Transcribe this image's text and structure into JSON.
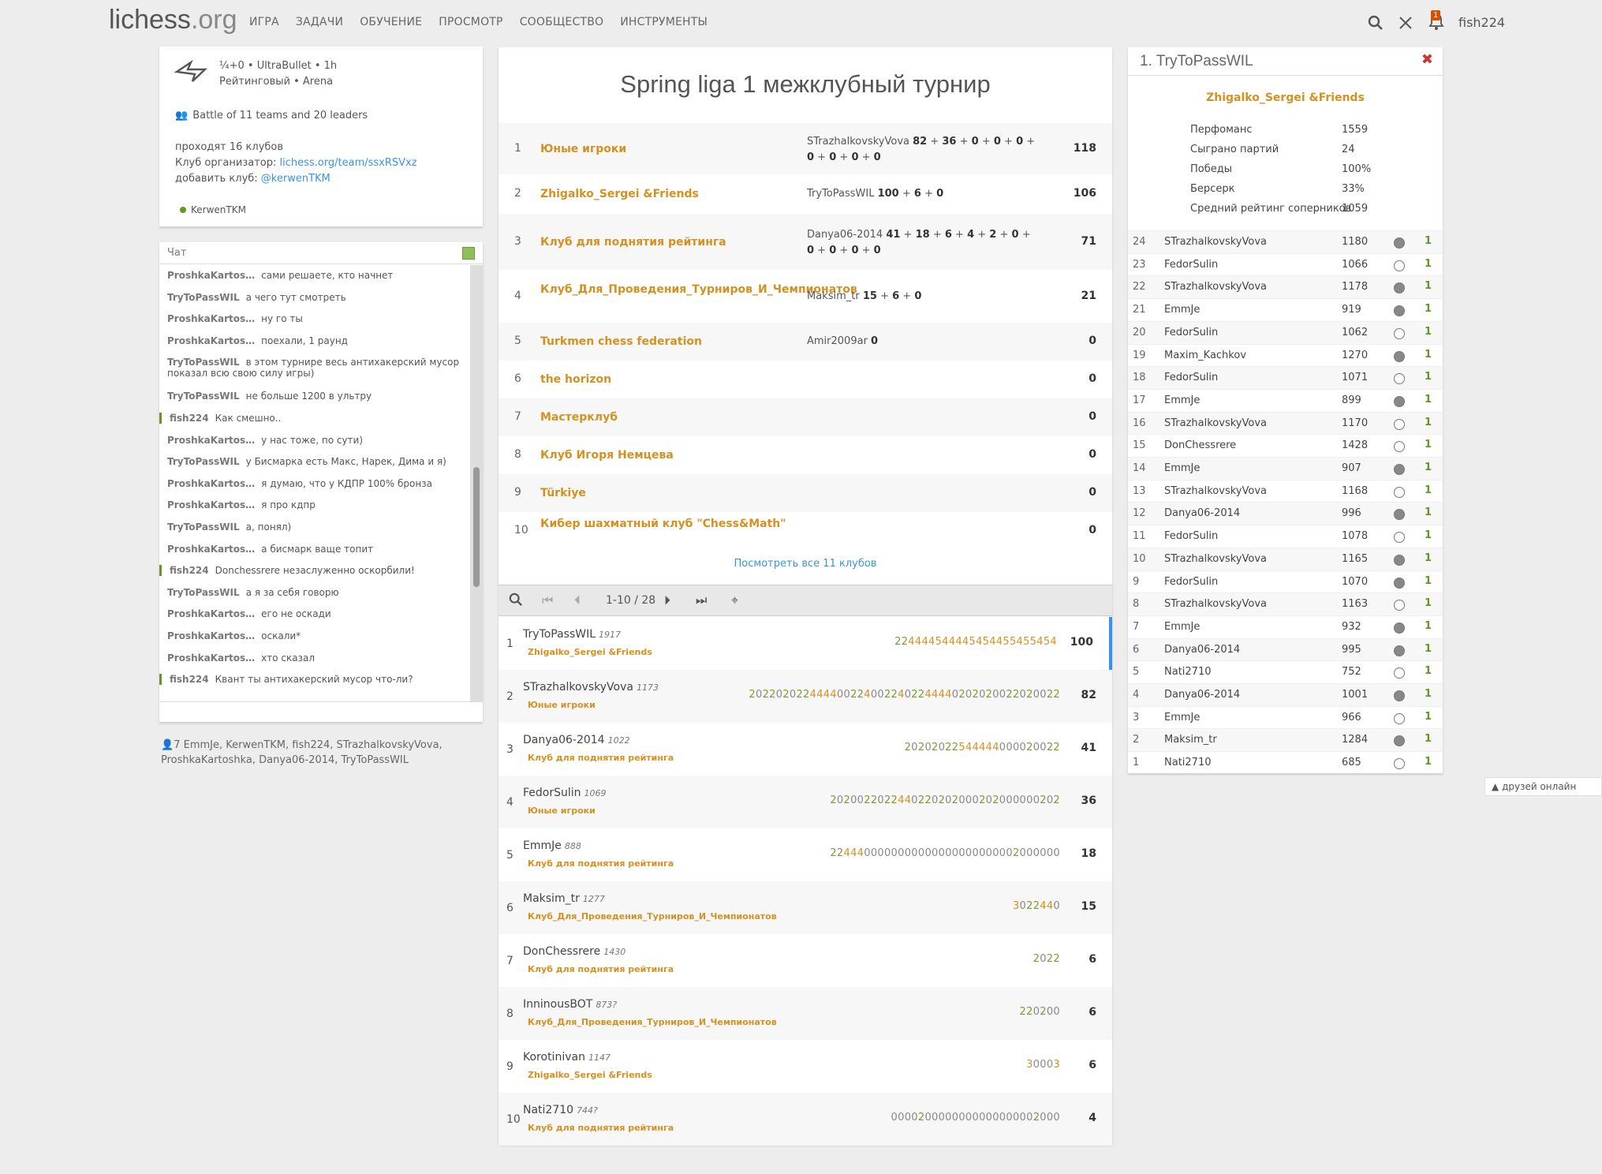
{
  "header": {
    "logo_main": "lichess",
    "logo_ext": ".org",
    "nav": [
      "ИГРА",
      "ЗАДАЧИ",
      "ОБУЧЕНИЕ",
      "ПРОСМОТР",
      "СООБЩЕСТВО",
      "ИНСТРУМЕНТЫ"
    ],
    "notif_count": "1",
    "username": "fish224",
    "icons": [
      "search-icon",
      "swords-icon",
      "bell-icon"
    ]
  },
  "info": {
    "line1": "¼+0 • UltraBullet • 1h",
    "line2": "Рейтинговый • Arena",
    "battle": "Battle of 11 teams and 20 leaders",
    "desc1": "проходят 16 клубов",
    "desc2_label": "Клуб организатор: ",
    "desc2_link": "lichess.org/team/ssxRSVxz",
    "desc3_label": "добавить клуб: ",
    "desc3_link": "@kerwenTKM",
    "creator": "KerwenTKM"
  },
  "chat": {
    "title": "Чат",
    "messages": [
      {
        "u": "ProshkaKartos…",
        "t": "сами решаете, кто начнет"
      },
      {
        "u": "TryToPassWIL",
        "t": "а чего тут смотреть"
      },
      {
        "u": "ProshkaKartos…",
        "t": "ну го ты"
      },
      {
        "u": "ProshkaKartos…",
        "t": "поехали, 1 раунд"
      },
      {
        "u": "TryToPassWIL",
        "t": "в этом турнире весь антихакерский мусор показал всю свою силу игры)"
      },
      {
        "u": "TryToPassWIL",
        "t": "не больше 1200 в ультру"
      },
      {
        "u": "fish224",
        "t": "Как смешно..",
        "me": true
      },
      {
        "u": "ProshkaKartos…",
        "t": "у нас тоже, по сути)"
      },
      {
        "u": "TryToPassWIL",
        "t": "у Бисмарка есть Макс, Нарек, Дима и я)"
      },
      {
        "u": "ProshkaKartos…",
        "t": "я думаю, что у КДПР 100% бронза"
      },
      {
        "u": "ProshkaKartos…",
        "t": "я про кдпр"
      },
      {
        "u": "TryToPassWIL",
        "t": "а, понял)"
      },
      {
        "u": "ProshkaKartos…",
        "t": "а бисмарк ваще топит"
      },
      {
        "u": "fish224",
        "t": "Donchessrere незаслуженно оскорбили!",
        "me": true
      },
      {
        "u": "TryToPassWIL",
        "t": "а я за себя говорю"
      },
      {
        "u": "ProshkaKartos…",
        "t": "его не оскади"
      },
      {
        "u": "ProshkaKartos…",
        "t": "оскали*"
      },
      {
        "u": "ProshkaKartos…",
        "t": "хто сказал"
      },
      {
        "u": "fish224",
        "t": "Квант ты антихакерский мусор что-ли?",
        "me": true
      }
    ]
  },
  "members": {
    "count": "7",
    "list": "EmmJe, KerwenTKM, fish224, STrazhalkovskyVova, ProshkaKartoshka, Danya06-2014, TryToPassWIL"
  },
  "tournament": {
    "title": "Spring liga 1 межклубный турнир",
    "see_all": "Посмотреть все 11 клубов",
    "page": "1-10 / 28",
    "teams": [
      {
        "rank": "1",
        "name": "Юные игроки",
        "leaders": "STrazhalkovskyVova <b>82</b> + <b>36</b> + <b>0</b> + <b>0</b> + <b>0</b> + <b>0</b> + <b>0</b> + <b>0</b> + <b>0</b>",
        "score": "118"
      },
      {
        "rank": "2",
        "name": "Zhigalko_Sergei &Friends",
        "leaders": "TryToPassWIL <b>100</b> + <b>6</b> + <b>0</b>",
        "score": "106"
      },
      {
        "rank": "3",
        "name": "Клуб для поднятия рейтинга",
        "leaders": "Danya06-2014 <b>41</b> + <b>18</b> + <b>6</b> + <b>4</b> + <b>2</b> + <b>0</b> + <b>0</b> + <b>0</b> + <b>0</b> + <b>0</b>",
        "score": "71"
      },
      {
        "rank": "4",
        "name": "Клуб_Для_Проведения_Турниров_И_Чемпионатов",
        "leaders": "Maksim_tr <b>15</b> + <b>6</b> + <b>0</b>",
        "score": "21"
      },
      {
        "rank": "5",
        "name": "Turkmen chess federation",
        "leaders": "Amir2009ar <b>0</b>",
        "score": "0"
      },
      {
        "rank": "6",
        "name": "the horizon",
        "leaders": "",
        "score": "0"
      },
      {
        "rank": "7",
        "name": "Мастерклуб",
        "leaders": "",
        "score": "0"
      },
      {
        "rank": "8",
        "name": "Клуб Игоря Немцева",
        "leaders": "",
        "score": "0"
      },
      {
        "rank": "9",
        "name": "Türkiye",
        "leaders": "",
        "score": "0"
      },
      {
        "rank": "10",
        "name": "Кибер шахматный клуб \"Chess&Math\"",
        "leaders": "",
        "score": "0"
      }
    ],
    "players": [
      {
        "rank": "1",
        "name": "TryToPassWIL",
        "rating": "1917",
        "team": "Zhigalko_Sergei &Friends",
        "sheet": "224444544445454455455454",
        "score": "100"
      },
      {
        "rank": "2",
        "name": "STrazhalkovskyVova",
        "rating": "1173",
        "team": "Юные игроки",
        "sheet": "2022020224444002240022402244440202020022020022",
        "score": "82"
      },
      {
        "rank": "3",
        "name": "Danya06-2014",
        "rating": "1022",
        "team": "Клуб для поднятия рейтинга",
        "sheet": "20202022544444000020022",
        "score": "41"
      },
      {
        "rank": "4",
        "name": "FedorSulin",
        "rating": "1069",
        "team": "Юные игроки",
        "sheet": "2020022022440220202000202000000202",
        "score": "36"
      },
      {
        "rank": "5",
        "name": "EmmJe",
        "rating": "888",
        "team": "Клуб для поднятия рейтинга",
        "sheet": "2244400000000000000000000002000000",
        "score": "18"
      },
      {
        "rank": "6",
        "name": "Maksim_tr",
        "rating": "1277",
        "team": "Клуб_Для_Проведения_Турниров_И_Чемпионатов",
        "sheet": "3022440",
        "score": "15"
      },
      {
        "rank": "7",
        "name": "DonChessrere",
        "rating": "1430",
        "team": "Клуб для поднятия рейтинга",
        "sheet": "2022",
        "score": "6"
      },
      {
        "rank": "8",
        "name": "InninousBOT",
        "rating": "873?",
        "team": "Клуб_Для_Проведения_Турниров_И_Чемпионатов",
        "sheet": "220200",
        "score": "6"
      },
      {
        "rank": "9",
        "name": "Korotinivan",
        "rating": "1147",
        "team": "Zhigalko_Sergei &Friends",
        "sheet": "30003",
        "score": "6"
      },
      {
        "rank": "10",
        "name": "Nati2710",
        "rating": "744?",
        "team": "Клуб для поднятия рейтинга",
        "sheet": "0000200000000000000002000",
        "score": "4"
      }
    ]
  },
  "player_panel": {
    "title": "1. TryToPassWIL",
    "team": "Zhigalko_Sergei &Friends",
    "stats": [
      {
        "label": "Перфоманс",
        "value": "1559"
      },
      {
        "label": "Сыграно партий",
        "value": "24"
      },
      {
        "label": "Победы",
        "value": "100%"
      },
      {
        "label": "Берсерк",
        "value": "33%"
      },
      {
        "label": "Средний рейтинг соперников",
        "value": "1059"
      }
    ],
    "games": [
      {
        "n": "24",
        "p": "STrazhalkovskyVova",
        "r": "1180",
        "c": "b",
        "s": "1"
      },
      {
        "n": "23",
        "p": "FedorSulin",
        "r": "1066",
        "c": "w",
        "s": "1"
      },
      {
        "n": "22",
        "p": "STrazhalkovskyVova",
        "r": "1178",
        "c": "b",
        "s": "1"
      },
      {
        "n": "21",
        "p": "EmmJe",
        "r": "919",
        "c": "b",
        "s": "1"
      },
      {
        "n": "20",
        "p": "FedorSulin",
        "r": "1062",
        "c": "w",
        "s": "1"
      },
      {
        "n": "19",
        "p": "Maxim_Kachkov",
        "r": "1270",
        "c": "b",
        "s": "1"
      },
      {
        "n": "18",
        "p": "FedorSulin",
        "r": "1071",
        "c": "w",
        "s": "1"
      },
      {
        "n": "17",
        "p": "EmmJe",
        "r": "899",
        "c": "b",
        "s": "1"
      },
      {
        "n": "16",
        "p": "STrazhalkovskyVova",
        "r": "1170",
        "c": "w",
        "s": "1"
      },
      {
        "n": "15",
        "p": "DonChessrere",
        "r": "1428",
        "c": "w",
        "s": "1"
      },
      {
        "n": "14",
        "p": "EmmJe",
        "r": "907",
        "c": "b",
        "s": "1"
      },
      {
        "n": "13",
        "p": "STrazhalkovskyVova",
        "r": "1168",
        "c": "w",
        "s": "1"
      },
      {
        "n": "12",
        "p": "Danya06-2014",
        "r": "996",
        "c": "b",
        "s": "1"
      },
      {
        "n": "11",
        "p": "FedorSulin",
        "r": "1078",
        "c": "w",
        "s": "1"
      },
      {
        "n": "10",
        "p": "STrazhalkovskyVova",
        "r": "1165",
        "c": "b",
        "s": "1"
      },
      {
        "n": "9",
        "p": "FedorSulin",
        "r": "1070",
        "c": "b",
        "s": "1"
      },
      {
        "n": "8",
        "p": "STrazhalkovskyVova",
        "r": "1163",
        "c": "w",
        "s": "1"
      },
      {
        "n": "7",
        "p": "EmmJe",
        "r": "932",
        "c": "b",
        "s": "1"
      },
      {
        "n": "6",
        "p": "Danya06-2014",
        "r": "995",
        "c": "b",
        "s": "1"
      },
      {
        "n": "5",
        "p": "Nati2710",
        "r": "752",
        "c": "w",
        "s": "1"
      },
      {
        "n": "4",
        "p": "Danya06-2014",
        "r": "1001",
        "c": "b",
        "s": "1"
      },
      {
        "n": "3",
        "p": "EmmJe",
        "r": "966",
        "c": "w",
        "s": "1"
      },
      {
        "n": "2",
        "p": "Maksim_tr",
        "r": "1284",
        "c": "b",
        "s": "1"
      },
      {
        "n": "1",
        "p": "Nati2710",
        "r": "685",
        "c": "w",
        "s": "1"
      }
    ]
  },
  "friends": {
    "label": "друзей онлайн"
  },
  "colors": {
    "accent": "#d59120",
    "link": "#3893e8",
    "win": "#629924"
  }
}
